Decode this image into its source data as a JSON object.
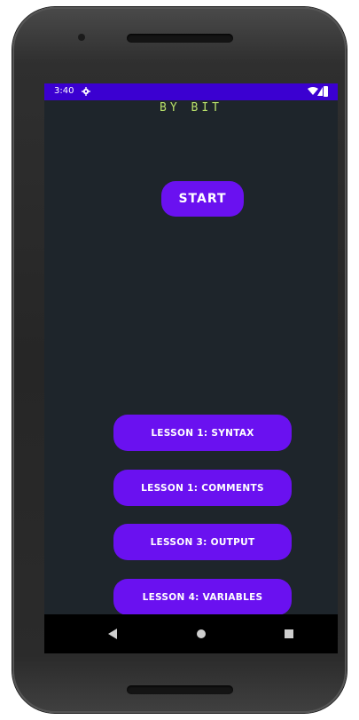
{
  "status_bar": {
    "time": "3:40",
    "icons": [
      "gear-icon",
      "wifi-icon",
      "cell-signal-icon",
      "battery-icon"
    ]
  },
  "app": {
    "title": "BY BIT",
    "start_label": "START",
    "lessons": [
      "LESSON 1: SYNTAX",
      "LESSON 1: COMMENTS",
      "LESSON 3: OUTPUT",
      "LESSON 4: VARIABLES"
    ]
  },
  "nav_bar": {
    "icons": [
      "back-icon",
      "home-icon",
      "recents-icon"
    ]
  },
  "colors": {
    "status_bar": "#3b00d1",
    "background": "#1e252b",
    "button": "#6a11f0",
    "title_text": "#b8e06a"
  }
}
